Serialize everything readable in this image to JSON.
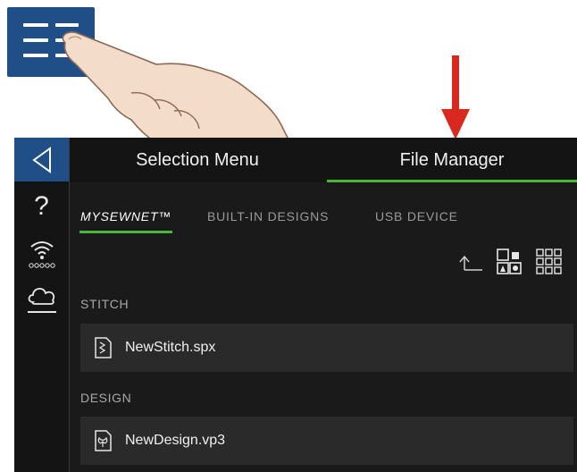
{
  "header": {
    "tabs": [
      {
        "label": "Selection Menu",
        "active": false
      },
      {
        "label": "File Manager",
        "active": true
      }
    ]
  },
  "subtabs": [
    {
      "label": "MYSEWNET™",
      "active": true
    },
    {
      "label": "BUILT-IN DESIGNS",
      "active": false
    },
    {
      "label": "USB DEVICE",
      "active": false
    }
  ],
  "sidebar": {
    "items": [
      {
        "icon": "back-arrow-icon"
      },
      {
        "icon": "help-icon",
        "text": "?"
      },
      {
        "icon": "wifi-icon"
      },
      {
        "icon": "cloud-icon"
      }
    ]
  },
  "toolbar": {
    "icons": [
      "folder-up-icon",
      "large-icon-view-icon",
      "list-grid-view-icon"
    ]
  },
  "sections": [
    {
      "label": "STITCH",
      "files": [
        {
          "name": "NewStitch.spx",
          "icon": "stitch-file-icon"
        }
      ]
    },
    {
      "label": "DESIGN",
      "files": [
        {
          "name": "NewDesign.vp3",
          "icon": "design-file-icon"
        }
      ]
    }
  ],
  "colors": {
    "accent": "#48b83a",
    "brand": "#1f4f86",
    "pointer_arrow": "#d9281f",
    "screen_bg": "#1a1a1a"
  }
}
